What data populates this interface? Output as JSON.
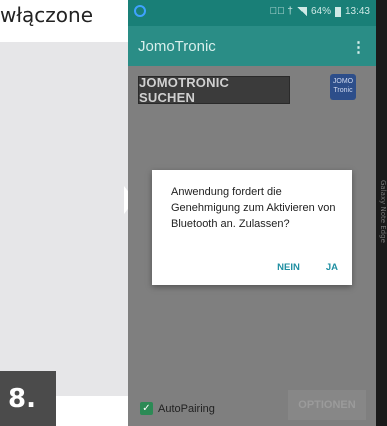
{
  "caption": {
    "text": "włączone",
    "step_number": "8."
  },
  "statusbar": {
    "indicators": "⊘⃥ †",
    "battery": "64%",
    "time": "13:43"
  },
  "app": {
    "title": "JomoTronic",
    "overflow_symbol": "⋮",
    "search_button": "JOMOTRONIC SUCHEN",
    "logo_line1": "JOMO",
    "logo_line2": "Tronic",
    "autopairing_label": "AutoPairing",
    "autopairing_checked": true,
    "optionen_button": "OPTIONEN"
  },
  "dialog": {
    "message": "Anwendung fordert die Genehmigung zum Aktivieren von Bluetooth an. Zulassen?",
    "deny_button": "NEIN",
    "allow_button": "JA"
  },
  "device": {
    "edge_text": "Galaxy Note Edge"
  },
  "colors": {
    "statusbar": "#197f77",
    "appbar": "#2a8d86",
    "dialog_action": "#1f8fa2",
    "checkbox": "#2c8a55"
  }
}
